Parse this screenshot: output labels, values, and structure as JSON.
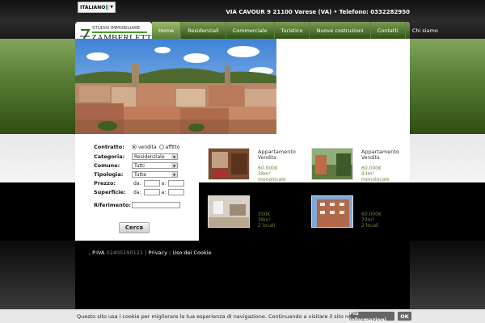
{
  "language": {
    "label": "ITALIANO",
    "flag_colors": [
      "#009246",
      "#ffffff",
      "#ce2b37"
    ]
  },
  "contact": "VIA CAVOUR 9 21100 Varese (VA) • Telefono: 0332282950",
  "logo": {
    "top": "STUDIO IMMOBILIARE",
    "name": "ZAMBERLETTI",
    "mark": "Z"
  },
  "nav": [
    "Home",
    "Residenziali",
    "Commerciale",
    "Turistico",
    "Nuove costruzioni",
    "Contatti",
    "Chi siamo"
  ],
  "search": {
    "contratto_label": "Contratto:",
    "contratto_options": [
      "vendita",
      "affitto"
    ],
    "categoria_label": "Categoria:",
    "categoria_value": "Residenziale",
    "comune_label": "Comune:",
    "comune_value": "Tutti",
    "tipologia_label": "Tipologia:",
    "tipologia_value": "Tutte",
    "prezzo_label": "Prezzo:",
    "superficie_label": "Superficie:",
    "da": "da:",
    "a": "a:",
    "riferimento_label": "Riferimento:",
    "submit": "Cerca"
  },
  "listings": [
    {
      "title": "Appartamento",
      "sub": "Vendita",
      "price": "60.000€",
      "area": "38m²",
      "rooms": "monolocale"
    },
    {
      "title": "Appartamento",
      "sub": "Vendita",
      "price": "60.000€",
      "area": "43m²",
      "rooms": "monolocale"
    },
    {
      "title": "",
      "sub": "",
      "price": "350€",
      "area": "38m²",
      "rooms": "2 locali"
    },
    {
      "title": "",
      "sub": "",
      "price": "60.000€",
      "area": "70m²",
      "rooms": "2 locali"
    }
  ],
  "footer": {
    "piva_label": ", P.IVA",
    "piva_value": "02405190121",
    "privacy": "Privacy",
    "cookie": "Uso dei Cookie"
  },
  "cookie_bar": {
    "text": "Questo sito usa i cookie per migliorare la tua esperienza di navigazione. Continuando a visitare il sito ne accetti l'uso.",
    "more": "Più informazioni",
    "ok": "OK"
  }
}
